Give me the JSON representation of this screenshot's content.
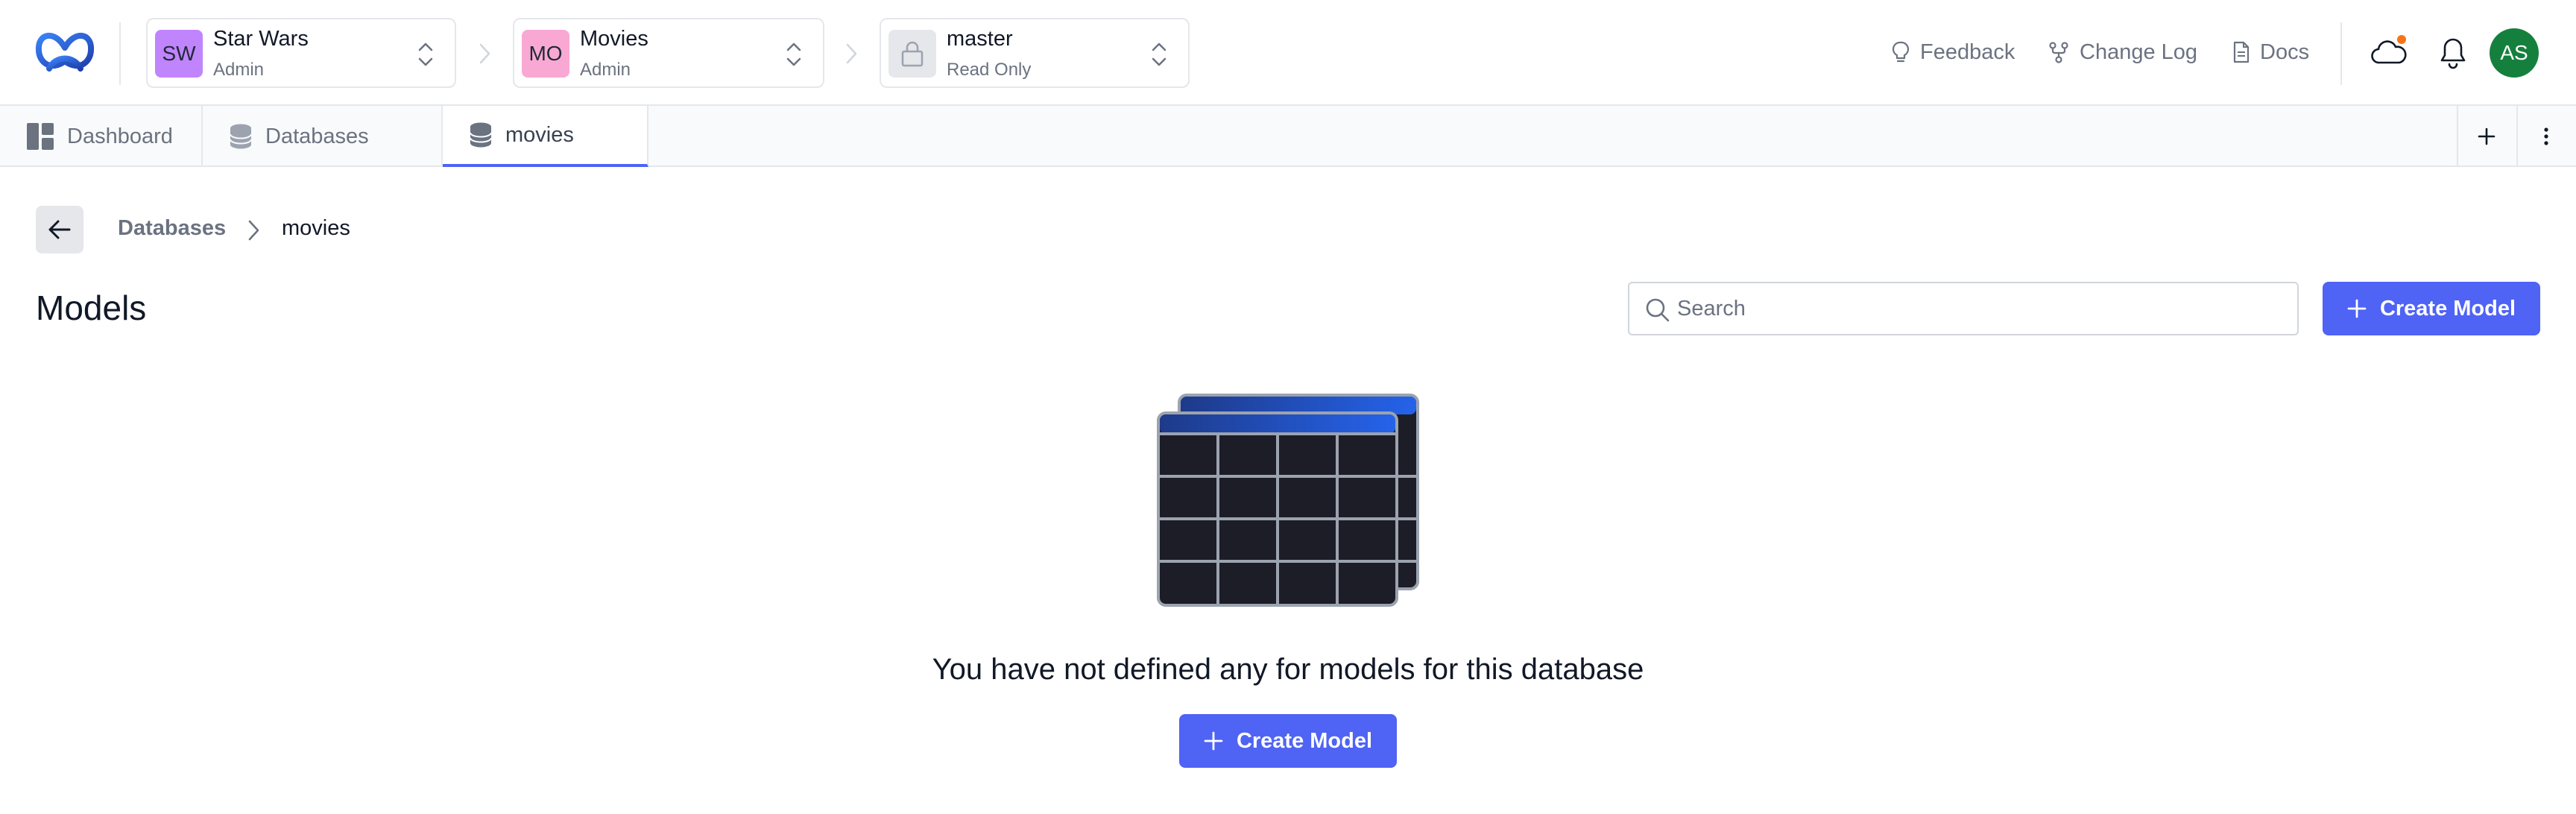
{
  "colors": {
    "accent": "#4f63f5",
    "org_avatar": "#c084fc",
    "project_avatar": "#f9a8d4",
    "user_avatar": "#15803d",
    "notification_dot": "#f97316"
  },
  "header": {
    "logo_icon": "butterfly-logo-icon",
    "org": {
      "initials": "SW",
      "name": "Star Wars",
      "role": "Admin"
    },
    "project": {
      "initials": "MO",
      "name": "Movies",
      "role": "Admin"
    },
    "branch": {
      "icon": "lock-icon",
      "name": "master",
      "role": "Read Only"
    },
    "links": {
      "feedback": "Feedback",
      "changelog": "Change Log",
      "docs": "Docs"
    },
    "cloud_icon": "cloud-icon",
    "bell_icon": "bell-icon",
    "user_initials": "AS"
  },
  "tabs": [
    {
      "label": "Dashboard",
      "icon": "dashboard-icon",
      "active": false
    },
    {
      "label": "Databases",
      "icon": "database-icon",
      "active": false
    },
    {
      "label": "movies",
      "icon": "database-icon",
      "active": true
    }
  ],
  "breadcrumb": {
    "parent": "Databases",
    "current": "movies"
  },
  "page": {
    "title": "Models",
    "search_placeholder": "Search",
    "create_button": "Create Model"
  },
  "empty_state": {
    "icon": "table-stack-icon",
    "message": "You have not defined any for models for this database",
    "button": "Create Model"
  }
}
